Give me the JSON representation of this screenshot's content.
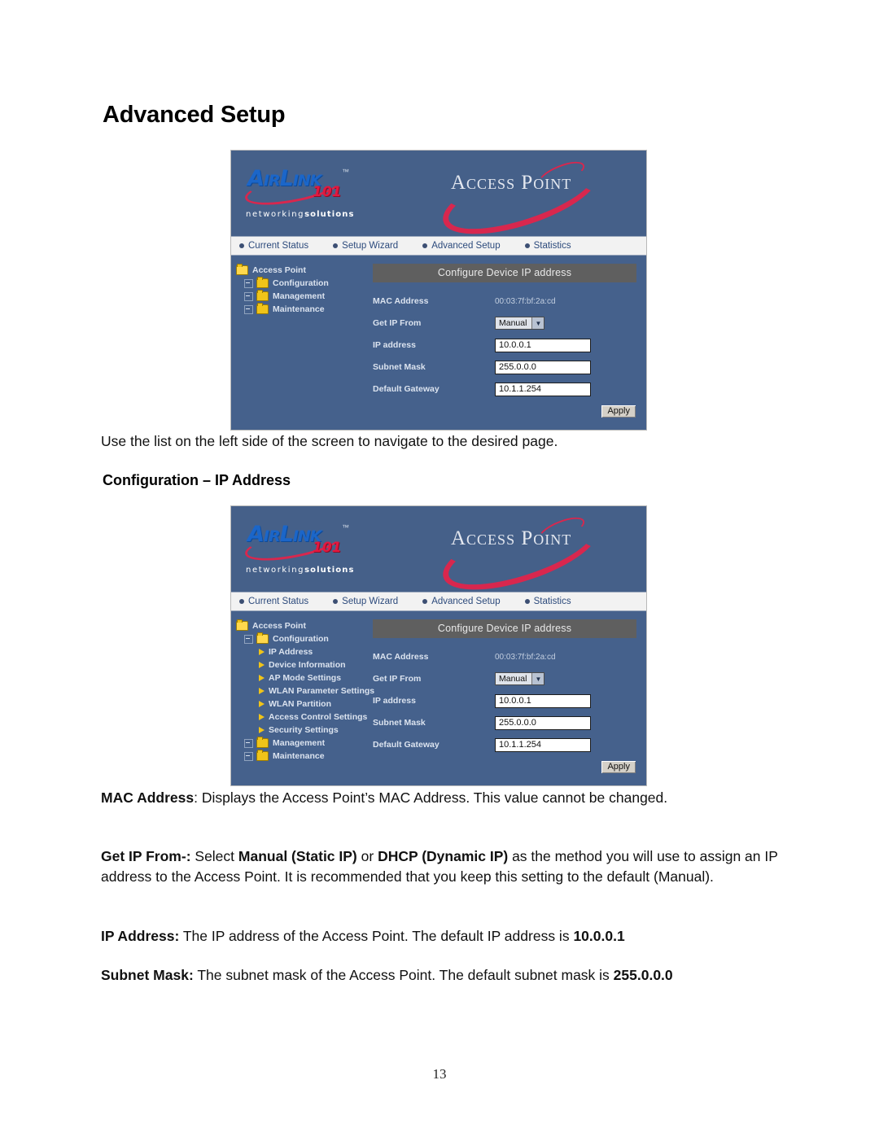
{
  "document": {
    "title": "Advanced Setup",
    "page_number": "13",
    "intro_text": "Use the list on the left side of the screen to navigate to the desired page.",
    "subheading": "Configuration – IP Address",
    "paragraphs": [
      {
        "term": "MAC Address",
        "separator": ":",
        "body": " Displays the Access Point’s MAC Address. This value cannot be changed."
      },
      {
        "term": "Get IP From-:",
        "separator": "",
        "body_parts": [
          {
            "text": " Select ",
            "bold": false
          },
          {
            "text": "Manual (Static IP)",
            "bold": true
          },
          {
            "text": " or ",
            "bold": false
          },
          {
            "text": "DHCP (Dynamic IP)",
            "bold": true
          },
          {
            "text": " as the method you will use to assign an IP address to the Access Point. It is recommended that you keep this setting to the default (Manual).",
            "bold": false
          }
        ]
      },
      {
        "term": "IP Address:",
        "separator": "",
        "body_parts": [
          {
            "text": " The IP address of the Access Point. The default IP address is ",
            "bold": false
          },
          {
            "text": "10.0.0.1",
            "bold": true
          }
        ]
      },
      {
        "term": "Subnet Mask:",
        "separator": "",
        "body_parts": [
          {
            "text": " The subnet mask of the Access Point. The default subnet mask is ",
            "bold": false
          },
          {
            "text": "255.0.0.0",
            "bold": true
          }
        ]
      }
    ]
  },
  "colors": {
    "panel_blue": "#45618c",
    "title_gray": "#5f5f5f",
    "logo_blue": "#1b66c9",
    "logo_red": "#d8274e",
    "folder_yellow": "#f0c419",
    "nav_text": "#2c4a7c"
  },
  "screenshot": {
    "brand": {
      "logo_main": "A",
      "logo_rest": "IR",
      "logo_link": "L",
      "logo_link_rest": "INK",
      "logo_badge": "101",
      "logo_tm": "™",
      "tagline_light": "networking",
      "tagline_bold": "solutions",
      "product": "Access Point"
    },
    "nav": [
      {
        "label": "Current Status",
        "icon": "bullet-icon"
      },
      {
        "label": "Setup Wizard",
        "icon": "bullet-icon"
      },
      {
        "label": "Advanced Setup",
        "icon": "bullet-icon"
      },
      {
        "label": "Statistics",
        "icon": "bullet-icon"
      }
    ],
    "form": {
      "title": "Configure Device IP address",
      "mac_label": "MAC Address",
      "mac_value": "00:03:7f:bf:2a:cd",
      "getip_label": "Get IP From",
      "getip_value": "Manual",
      "getip_caret": "▼",
      "ip_label": "IP address",
      "ip_value": "10.0.0.1",
      "mask_label": "Subnet Mask",
      "mask_value": "255.0.0.0",
      "gw_label": "Default Gateway",
      "gw_value": "10.1.1.254",
      "apply_label": "Apply"
    },
    "tree_collapsed": [
      {
        "label": "Access Point",
        "level": 1,
        "icon": "folder-open-icon",
        "expander": false
      },
      {
        "label": "Configuration",
        "level": 2,
        "icon": "folder-icon",
        "expander": true
      },
      {
        "label": "Management",
        "level": 2,
        "icon": "folder-icon",
        "expander": true
      },
      {
        "label": "Maintenance",
        "level": 2,
        "icon": "folder-icon",
        "expander": true
      }
    ],
    "tree_expanded": [
      {
        "label": "Access Point",
        "level": 1,
        "icon": "folder-open-icon",
        "expander": false
      },
      {
        "label": "Configuration",
        "level": 2,
        "icon": "folder-open-icon",
        "expander": true
      },
      {
        "label": "IP Address",
        "level": 3,
        "icon": "flag-icon",
        "expander": false
      },
      {
        "label": "Device Information",
        "level": 3,
        "icon": "flag-icon",
        "expander": false
      },
      {
        "label": "AP Mode Settings",
        "level": 3,
        "icon": "flag-icon",
        "expander": false
      },
      {
        "label": "WLAN Parameter Settings",
        "level": 3,
        "icon": "flag-icon",
        "expander": false
      },
      {
        "label": "WLAN Partition",
        "level": 3,
        "icon": "flag-icon",
        "expander": false
      },
      {
        "label": "Access Control Settings",
        "level": 3,
        "icon": "flag-icon",
        "expander": false
      },
      {
        "label": "Security Settings",
        "level": 3,
        "icon": "flag-icon",
        "expander": false
      },
      {
        "label": "Management",
        "level": 2,
        "icon": "folder-icon",
        "expander": true
      },
      {
        "label": "Maintenance",
        "level": 2,
        "icon": "folder-icon",
        "expander": true
      }
    ]
  }
}
